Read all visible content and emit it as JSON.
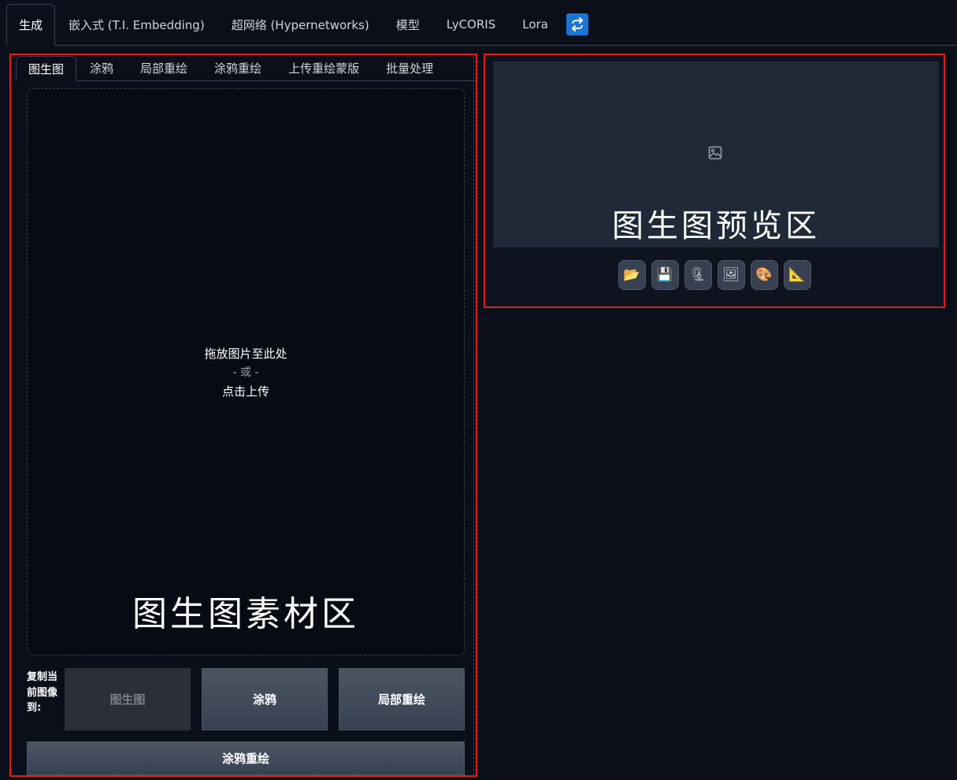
{
  "top_tabs": [
    {
      "label": "生成",
      "active": true
    },
    {
      "label": "嵌入式 (T.I. Embedding)"
    },
    {
      "label": "超网络 (Hypernetworks)"
    },
    {
      "label": "模型"
    },
    {
      "label": "LyCORIS"
    },
    {
      "label": "Lora"
    }
  ],
  "refresh_icon": "refresh-icon",
  "sub_tabs": [
    {
      "label": "图生图",
      "active": true
    },
    {
      "label": "涂鸦"
    },
    {
      "label": "局部重绘"
    },
    {
      "label": "涂鸦重绘"
    },
    {
      "label": "上传重绘蒙版"
    },
    {
      "label": "批量处理"
    }
  ],
  "dropzone": {
    "line1": "拖放图片至此处",
    "or": "- 或 -",
    "line2": "点击上传",
    "overlay_label": "图生图素材区"
  },
  "copy": {
    "label": "复制当前图像到:",
    "buttons": [
      "图生图",
      "涂鸦",
      "局部重绘"
    ],
    "full_button": "涂鸦重绘"
  },
  "preview": {
    "icon": "image-icon",
    "overlay_label": "图生图预览区"
  },
  "tools": [
    {
      "name": "open-folder-icon",
      "glyph": "📂"
    },
    {
      "name": "save-icon",
      "glyph": "💾"
    },
    {
      "name": "zip-icon",
      "glyph": "🗜"
    },
    {
      "name": "send-to-img2img-icon",
      "glyph": "🖼"
    },
    {
      "name": "send-to-inpaint-icon",
      "glyph": "🎨"
    },
    {
      "name": "send-to-extras-icon",
      "glyph": "📐"
    }
  ],
  "colors": {
    "accent": "#1d74d8",
    "highlight_border": "#e0201a",
    "background": "#0b0f19"
  }
}
